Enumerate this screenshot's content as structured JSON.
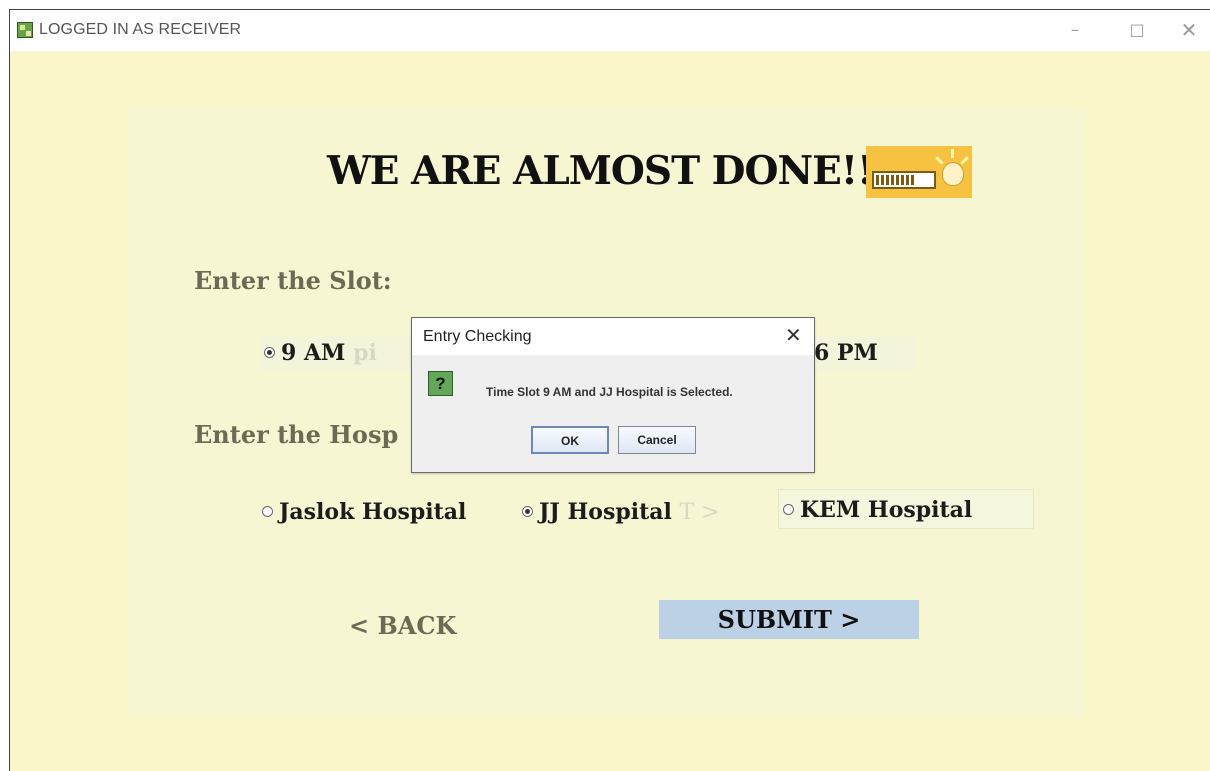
{
  "window": {
    "title": "LOGGED IN AS RECEIVER",
    "controls": {
      "minimize": "–",
      "maximize": "□",
      "close": "✕"
    }
  },
  "main": {
    "heading": "WE ARE ALMOST DONE!!..",
    "heading_icon": "progress-bulb-icon",
    "slot_label": "Enter the Slot:",
    "slot_options": [
      {
        "label": "9 AM",
        "selected": true
      },
      {
        "label": "6 PM",
        "selected": false
      }
    ],
    "hospital_label": "Enter the Hosp",
    "hospital_options": [
      {
        "label": "Jaslok Hospital",
        "selected": false
      },
      {
        "label": "JJ Hospital",
        "selected": true
      },
      {
        "label": "KEM Hospital",
        "selected": false
      }
    ],
    "ghost_text": {
      "slot_row": "pi",
      "hospital_row": "T >"
    },
    "back_label": "< BACK",
    "submit_label": "SUBMIT >"
  },
  "dialog": {
    "title": "Entry Checking",
    "close": "✕",
    "icon": "question-icon",
    "icon_glyph": "?",
    "message": "Time Slot 9 AM and JJ Hospital is Selected.",
    "ok_label": "OK",
    "cancel_label": "Cancel"
  },
  "colors": {
    "background": "#fbf6c9",
    "panel": "#f7f6d3",
    "submit": "#bcd0e6"
  }
}
